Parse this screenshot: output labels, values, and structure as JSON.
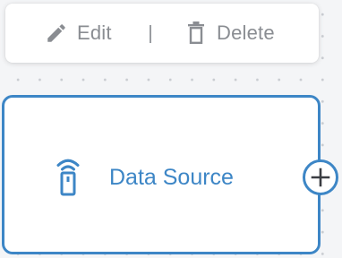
{
  "toolbar": {
    "edit_label": "Edit",
    "delete_label": "Delete",
    "edit_icon": "pencil-icon",
    "delete_icon": "trash-icon"
  },
  "node": {
    "label": "Data Source",
    "icon": "remote-signal-icon",
    "add_icon": "plus-circle-icon"
  },
  "colors": {
    "accent": "#3d86c6",
    "toolbar_text": "#8a8d92",
    "canvas": "#f4f5f7",
    "grid_dot": "#c9ccd1"
  }
}
